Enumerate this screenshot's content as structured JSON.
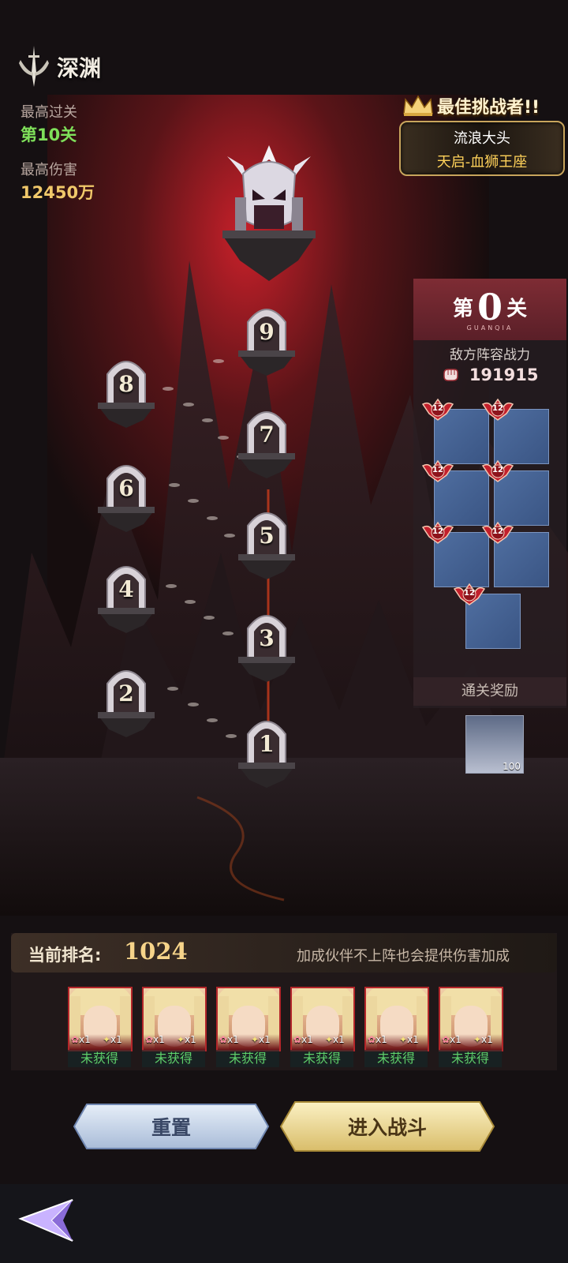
{
  "header": {
    "title": "深渊",
    "best_level_label": "最高过关",
    "best_level_value": "第10关",
    "best_damage_label": "最高伤害",
    "best_damage_value": "12450万"
  },
  "best_challenger": {
    "title": "最佳挑战者!!",
    "name": "流浪大头",
    "honor_title": "天启-血狮王座"
  },
  "stages": [
    "1",
    "2",
    "3",
    "4",
    "5",
    "6",
    "7",
    "8",
    "9"
  ],
  "panel": {
    "level_prefix": "第",
    "level_number": "0",
    "level_suffix": "关",
    "level_pinyin": "GUANQIA",
    "enemy_label": "敌方阵容战力",
    "enemy_power": "191915",
    "slot_badges": [
      "12",
      "12",
      "12",
      "12",
      "12",
      "12",
      "12"
    ],
    "reward_label": "通关奖励",
    "reward_count": "100"
  },
  "ranking": {
    "label": "当前排名:",
    "value": "1024",
    "hint": "加成伙伴不上阵也会提供伤害加成"
  },
  "partners": [
    {
      "count_a": "x1",
      "count_b": "x1",
      "status": "未获得"
    },
    {
      "count_a": "x1",
      "count_b": "x1",
      "status": "未获得"
    },
    {
      "count_a": "x1",
      "count_b": "x1",
      "status": "未获得"
    },
    {
      "count_a": "x1",
      "count_b": "x1",
      "status": "未获得"
    },
    {
      "count_a": "x1",
      "count_b": "x1",
      "status": "未获得"
    },
    {
      "count_a": "x1",
      "count_b": "x1",
      "status": "未获得"
    }
  ],
  "buttons": {
    "reset": "重置",
    "enter_battle": "进入战斗"
  },
  "icons": [
    "sword-emblem-icon",
    "crown-icon",
    "fist-icon",
    "back-arrow-icon"
  ],
  "colors": {
    "accent_gold": "#f0c86a",
    "accent_green": "#7fe05a",
    "panel_red": "#7e2c34",
    "slot_blue": "#4f6ea0"
  }
}
